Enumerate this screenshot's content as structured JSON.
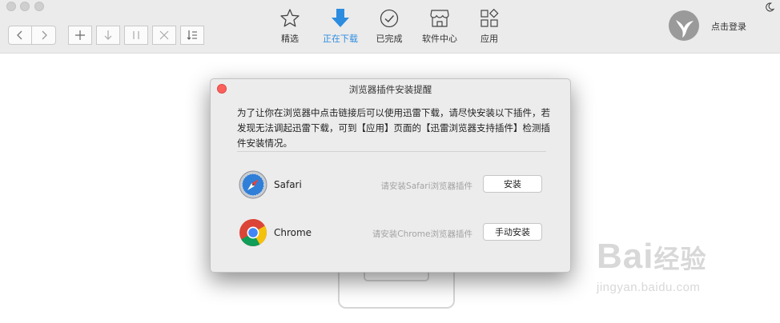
{
  "toolbar": {
    "nav_tabs": [
      {
        "label": "精选",
        "icon": "star-icon",
        "active": false
      },
      {
        "label": "正在下载",
        "icon": "download-arrow-icon",
        "active": true
      },
      {
        "label": "已完成",
        "icon": "check-circle-icon",
        "active": false
      },
      {
        "label": "软件中心",
        "icon": "store-icon",
        "active": false
      },
      {
        "label": "应用",
        "icon": "apps-grid-icon",
        "active": false
      }
    ],
    "login_label": "点击登录"
  },
  "dialog": {
    "title": "浏览器插件安装提醒",
    "message": "为了让你在浏览器中点击链接后可以使用迅雷下载，请尽快安装以下插件，若发现无法调起迅雷下载，可到【应用】页面的【迅雷浏览器支持插件】检测插件安装情况。",
    "plugins": [
      {
        "name": "Safari",
        "hint": "请安装Safari浏览器插件",
        "button": "安装",
        "icon": "safari-icon"
      },
      {
        "name": "Chrome",
        "hint": "请安装Chrome浏览器插件",
        "button": "手动安装",
        "icon": "chrome-icon"
      }
    ]
  },
  "watermark": {
    "line1": "Bai",
    "line1_cn": "经验",
    "line2": "jingyan.baidu.com"
  },
  "colors": {
    "accent": "#2c8ce0",
    "close": "#fc605c",
    "toolbar_bg": "#ebebeb",
    "dialog_bg": "#ececec"
  }
}
